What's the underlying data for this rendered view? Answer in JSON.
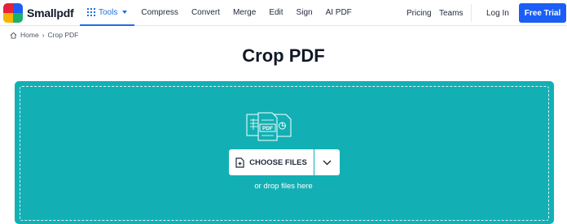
{
  "brand": {
    "name": "Smallpdf",
    "logo_colors": [
      "#e8213a",
      "#1a5ef5",
      "#f6b300",
      "#18b36b"
    ]
  },
  "nav": {
    "tools_label": "Tools",
    "items": [
      "Compress",
      "Convert",
      "Merge",
      "Edit",
      "Sign",
      "AI PDF"
    ],
    "right_items": [
      "Pricing",
      "Teams"
    ],
    "login_label": "Log In",
    "trial_label": "Free Trial"
  },
  "breadcrumb": {
    "home": "Home",
    "separator": "›",
    "current": "Crop PDF"
  },
  "page": {
    "title": "Crop PDF"
  },
  "upload": {
    "choose_label": "CHOOSE FILES",
    "drop_hint": "or drop files here",
    "file_badge": "PDF",
    "accent_color": "#12b0b4"
  },
  "icons": {
    "tools": "grid-icon",
    "home": "home-icon",
    "choose": "file-plus-icon",
    "dropdown": "chevron-down-icon"
  }
}
